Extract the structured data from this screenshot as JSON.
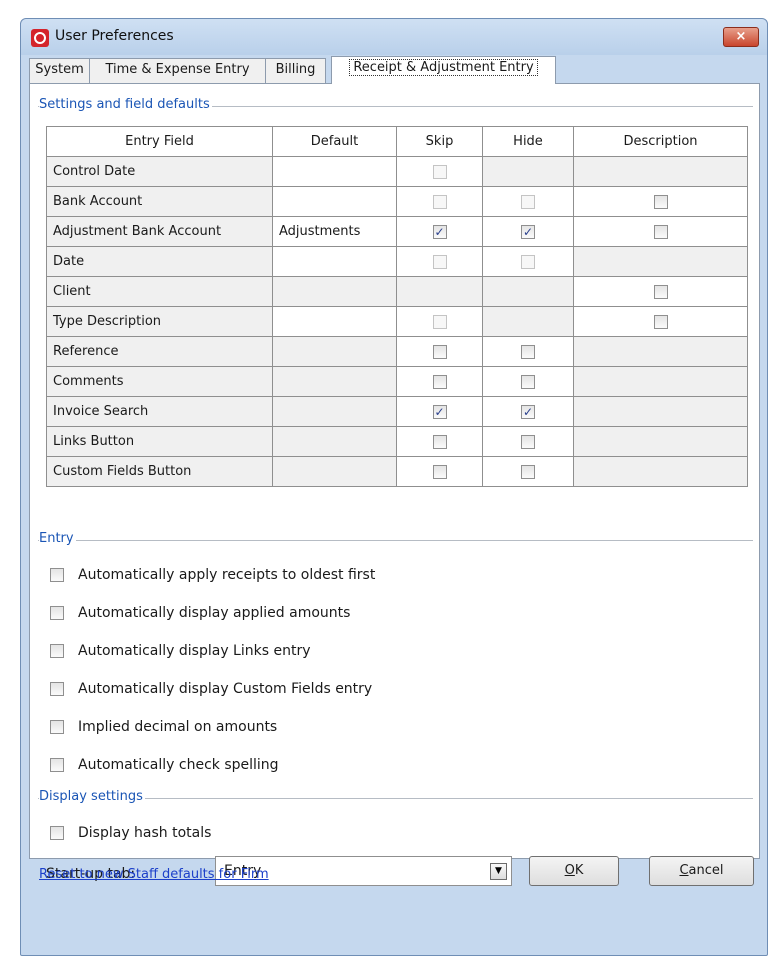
{
  "window": {
    "title": "User Preferences",
    "close_label": "×"
  },
  "tabs": [
    {
      "label": "System",
      "active": false
    },
    {
      "label": "Time & Expense Entry",
      "active": false
    },
    {
      "label": "Billing",
      "active": false
    },
    {
      "label": "Receipt & Adjustment Entry",
      "active": true
    }
  ],
  "settings": {
    "title": "Settings and field defaults",
    "columns": [
      "Entry Field",
      "Default",
      "Skip",
      "Hide",
      "Description"
    ],
    "rows": [
      {
        "field": "Control Date",
        "default": "",
        "skip": "unchecked-disabled",
        "hide": "none",
        "description": "none"
      },
      {
        "field": "Bank Account",
        "default": "",
        "skip": "unchecked-disabled",
        "hide": "unchecked-disabled",
        "description": "unchecked"
      },
      {
        "field": "Adjustment Bank Account",
        "default": "Adjustments",
        "skip": "checked",
        "hide": "checked",
        "description": "unchecked"
      },
      {
        "field": "Date",
        "default": "",
        "skip": "unchecked-disabled",
        "hide": "unchecked-disabled",
        "description": "none"
      },
      {
        "field": "Client",
        "default": "",
        "skip": "none",
        "hide": "none",
        "description": "unchecked"
      },
      {
        "field": "Type Description",
        "default": "",
        "skip": "unchecked-disabled",
        "hide": "none",
        "description": "unchecked"
      },
      {
        "field": "Reference",
        "default": "",
        "skip": "unchecked",
        "hide": "unchecked",
        "description": "none"
      },
      {
        "field": "Comments",
        "default": "",
        "skip": "unchecked",
        "hide": "unchecked",
        "description": "none"
      },
      {
        "field": "Invoice Search",
        "default": "",
        "skip": "checked",
        "hide": "checked",
        "description": "none"
      },
      {
        "field": "Links Button",
        "default": "",
        "skip": "unchecked",
        "hide": "unchecked",
        "description": "none"
      },
      {
        "field": "Custom Fields Button",
        "default": "",
        "skip": "unchecked",
        "hide": "unchecked",
        "description": "none"
      }
    ]
  },
  "entry": {
    "title": "Entry",
    "options": [
      {
        "label": "Automatically apply receipts to oldest first",
        "checked": false
      },
      {
        "label": "Automatically display applied amounts",
        "checked": false
      },
      {
        "label": "Automatically display Links entry",
        "checked": false
      },
      {
        "label": "Automatically display Custom Fields entry",
        "checked": false
      },
      {
        "label": "Implied decimal on amounts",
        "checked": false
      },
      {
        "label": "Automatically check spelling",
        "checked": false
      }
    ]
  },
  "display": {
    "title": "Display settings",
    "hash_totals_label": "Display hash totals",
    "hash_totals_checked": false,
    "startup_label": "Start-up tab:",
    "startup_value": "Entry"
  },
  "footer": {
    "reset_link": "Reset to new Staff defaults for Firm",
    "ok_accel": "O",
    "ok_rest": "K",
    "cancel_accel": "C",
    "cancel_rest": "ancel"
  }
}
